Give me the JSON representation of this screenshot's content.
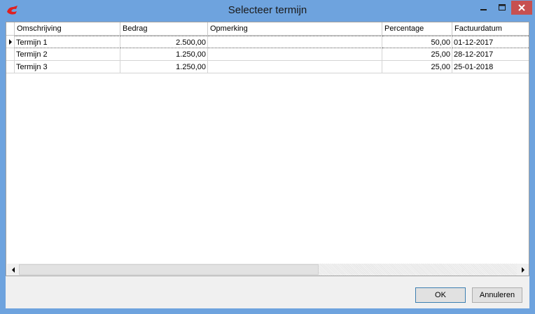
{
  "window": {
    "title": "Selecteer termijn"
  },
  "table": {
    "columns": [
      "Omschrijving",
      "Bedrag",
      "Opmerking",
      "Percentage",
      "Factuurdatum"
    ],
    "rows": [
      {
        "omschrijving": "Termijn 1",
        "bedrag": "2.500,00",
        "opmerking": "",
        "percentage": "50,00",
        "factuurdatum": "01-12-2017"
      },
      {
        "omschrijving": "Termijn 2",
        "bedrag": "1.250,00",
        "opmerking": "",
        "percentage": "25,00",
        "factuurdatum": "28-12-2017"
      },
      {
        "omschrijving": "Termijn 3",
        "bedrag": "1.250,00",
        "opmerking": "",
        "percentage": "25,00",
        "factuurdatum": "25-01-2018"
      }
    ]
  },
  "buttons": {
    "ok": "OK",
    "cancel": "Annuleren"
  },
  "colors": {
    "titlebar": "#6ea3de",
    "close": "#c75050",
    "app_icon": "#e02020"
  }
}
